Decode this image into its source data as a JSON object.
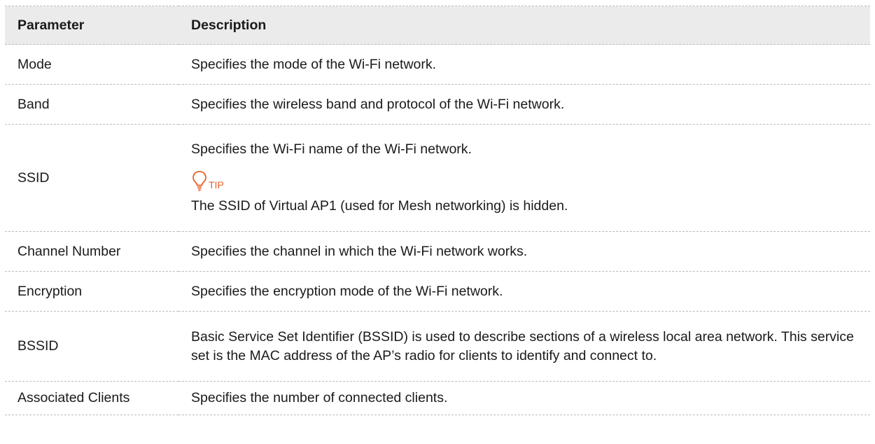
{
  "table": {
    "headers": {
      "parameter": "Parameter",
      "description": "Description"
    },
    "rows": [
      {
        "parameter": "Mode",
        "description": "Specifies the mode of the Wi-Fi network."
      },
      {
        "parameter": "Band",
        "description": "Specifies the wireless band and protocol of the Wi-Fi network."
      },
      {
        "parameter": "SSID",
        "description": "Specifies the Wi-Fi name of the Wi-Fi network.",
        "tip_label": "TIP",
        "tip_text": "The SSID of Virtual AP1 (used for Mesh networking) is hidden."
      },
      {
        "parameter": "Channel Number",
        "description": "Specifies the channel in which the Wi-Fi network works."
      },
      {
        "parameter": "Encryption",
        "description": "Specifies the encryption mode of the Wi-Fi network."
      },
      {
        "parameter": "BSSID",
        "description": "Basic Service Set Identifier (BSSID) is used to describe sections of a wireless local area network. This service set is the MAC address of the AP’s radio for clients to identify and connect to."
      },
      {
        "parameter": "Associated Clients",
        "description": "Specifies the number of connected clients."
      }
    ]
  },
  "colors": {
    "header_bg": "#ebebeb",
    "tip_accent": "#e8622a",
    "rule": "#bdbdbd"
  },
  "icons": {
    "tip": "lightbulb-icon"
  }
}
